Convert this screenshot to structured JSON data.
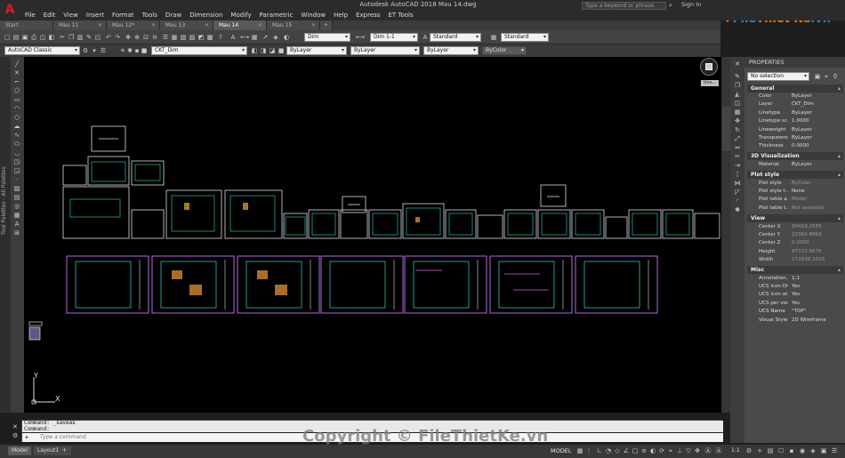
{
  "titlebar": {
    "app_logo_letter": "A",
    "title": "Autodesk AutoCAD 2018    Mau 14.dwg",
    "search_placeholder": "Type a keyword or phrase",
    "sign_in": "Sign In"
  },
  "menu": [
    "File",
    "Edit",
    "View",
    "Insert",
    "Format",
    "Tools",
    "Draw",
    "Dimension",
    "Modify",
    "Parametric",
    "Window",
    "Help",
    "Express",
    "ET Tools"
  ],
  "tabs": [
    {
      "label": "Start",
      "active": false
    },
    {
      "label": "Mau 11",
      "active": false
    },
    {
      "label": "Mau 12*",
      "active": false
    },
    {
      "label": "Mau 13",
      "active": false
    },
    {
      "label": "Mau 14",
      "active": true
    },
    {
      "label": "Mau 15",
      "active": false
    }
  ],
  "toolbar1": {
    "dimstyle_combo": "Dim",
    "dimscale_combo": "Dim 1-1",
    "textstyle_combo": "Standard",
    "tablestyle_combo": "Standard"
  },
  "toolbar2": {
    "workspace_combo": "AutoCAD Classic",
    "layer_combo": "CKT_Dim",
    "color_combo": "ByLayer",
    "linetype_combo": "ByLayer",
    "lineweight_combo": "ByLayer",
    "plotstyle_combo": "ByColor"
  },
  "tool_palette_label": "Tool Palettes - All Palettes",
  "viewcube": {
    "unsaved_label": "Uns..."
  },
  "ucs": {
    "x_label": "X",
    "y_label": "Y"
  },
  "properties": {
    "header": "PROPERTIES",
    "selection": "No selection",
    "sections": [
      {
        "title": "General",
        "rows": [
          {
            "k": "Color",
            "v": "ByLayer"
          },
          {
            "k": "Layer",
            "v": "CKT_Dim"
          },
          {
            "k": "Linetype",
            "v": "ByLayer"
          },
          {
            "k": "Linetype sc...",
            "v": "1.0000"
          },
          {
            "k": "Lineweight",
            "v": "ByLayer"
          },
          {
            "k": "Transparency",
            "v": "ByLayer"
          },
          {
            "k": "Thickness",
            "v": "0.0000"
          }
        ]
      },
      {
        "title": "3D Visualization",
        "rows": [
          {
            "k": "Material",
            "v": "ByLayer"
          }
        ]
      },
      {
        "title": "Plot style",
        "rows": [
          {
            "k": "Plot style",
            "v": "ByColor"
          },
          {
            "k": "Plot style t...",
            "v": "None"
          },
          {
            "k": "Plot table a...",
            "v": "Model"
          },
          {
            "k": "Plot table t...",
            "v": "Not available"
          }
        ]
      },
      {
        "title": "View",
        "rows": [
          {
            "k": "Center X",
            "v": "90419.2585"
          },
          {
            "k": "Center Y",
            "v": "22360.8869"
          },
          {
            "k": "Center Z",
            "v": "0.0000"
          },
          {
            "k": "Height",
            "v": "87723.8575"
          },
          {
            "k": "Width",
            "v": "172938.2016"
          }
        ]
      },
      {
        "title": "Misc",
        "rows": [
          {
            "k": "Annotation...",
            "v": "1:1"
          },
          {
            "k": "UCS icon On",
            "v": "Yes"
          },
          {
            "k": "UCS icon at...",
            "v": "Yes"
          },
          {
            "k": "UCS per vie...",
            "v": "Yes"
          },
          {
            "k": "UCS Name",
            "v": "\"TOP\""
          },
          {
            "k": "Visual Style",
            "v": "2D Wireframe"
          }
        ]
      }
    ]
  },
  "command": {
    "history": [
      "Command: _saveas",
      "Command:"
    ],
    "input_placeholder": "Type a command"
  },
  "status": {
    "layout_tabs": [
      "Model",
      "Layout1"
    ],
    "model_label": "MODEL",
    "scale": "1:1"
  },
  "watermark": "Copyright © FileThietKe.vn",
  "site_logo": {
    "text1": "File",
    "text2": "Thiết Kế",
    "text3": ".vn"
  },
  "colors": {
    "autocad_red": "#d21f1f",
    "canvas": "#000000",
    "sheet_border_purple": "#b06cd8",
    "sheet_border_white": "#dcdcdc",
    "drawing_cyan": "#38d6d6"
  }
}
